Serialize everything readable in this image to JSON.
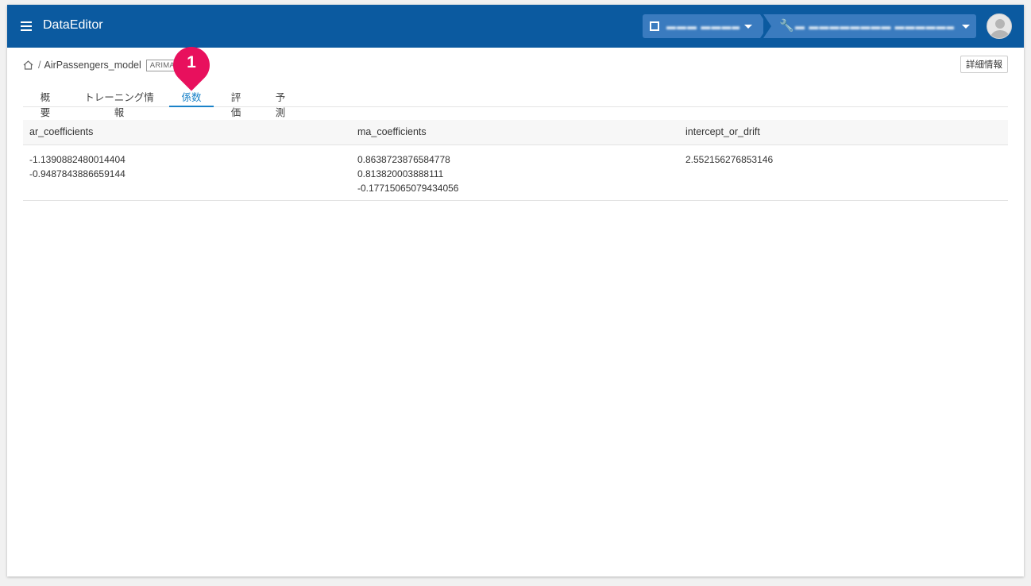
{
  "app": {
    "title": "DataEditor",
    "org_selector": {
      "text": "▬▬▬ ▬▬▬▬▬▬▬▬"
    },
    "project_selector": {
      "text": "▬ ▬▬▬▬▬▬▬▬ ▬▬▬▬▬▬ ▬▬▬▬▬▬▬▬▬"
    },
    "accent_color": "#0b5aa0"
  },
  "breadcrumb": {
    "model_name": "AirPassengers_model",
    "badge": "ARIMA"
  },
  "detail_button": "詳細情報",
  "tabs": [
    {
      "label": "概要"
    },
    {
      "label": "トレーニング情報"
    },
    {
      "label": "係数",
      "active": true
    },
    {
      "label": "評価"
    },
    {
      "label": "予測"
    }
  ],
  "step_marker": "1",
  "table": {
    "headers": [
      "ar_coefficients",
      "ma_coefficients",
      "intercept_or_drift"
    ],
    "ar_values": [
      "-1.1390882480014404",
      "-0.9487843886659144"
    ],
    "ma_values": [
      "0.8638723876584778",
      "0.813820003888111",
      "-0.17715065079434056"
    ],
    "intercept_values": [
      "2.552156276853146"
    ]
  }
}
